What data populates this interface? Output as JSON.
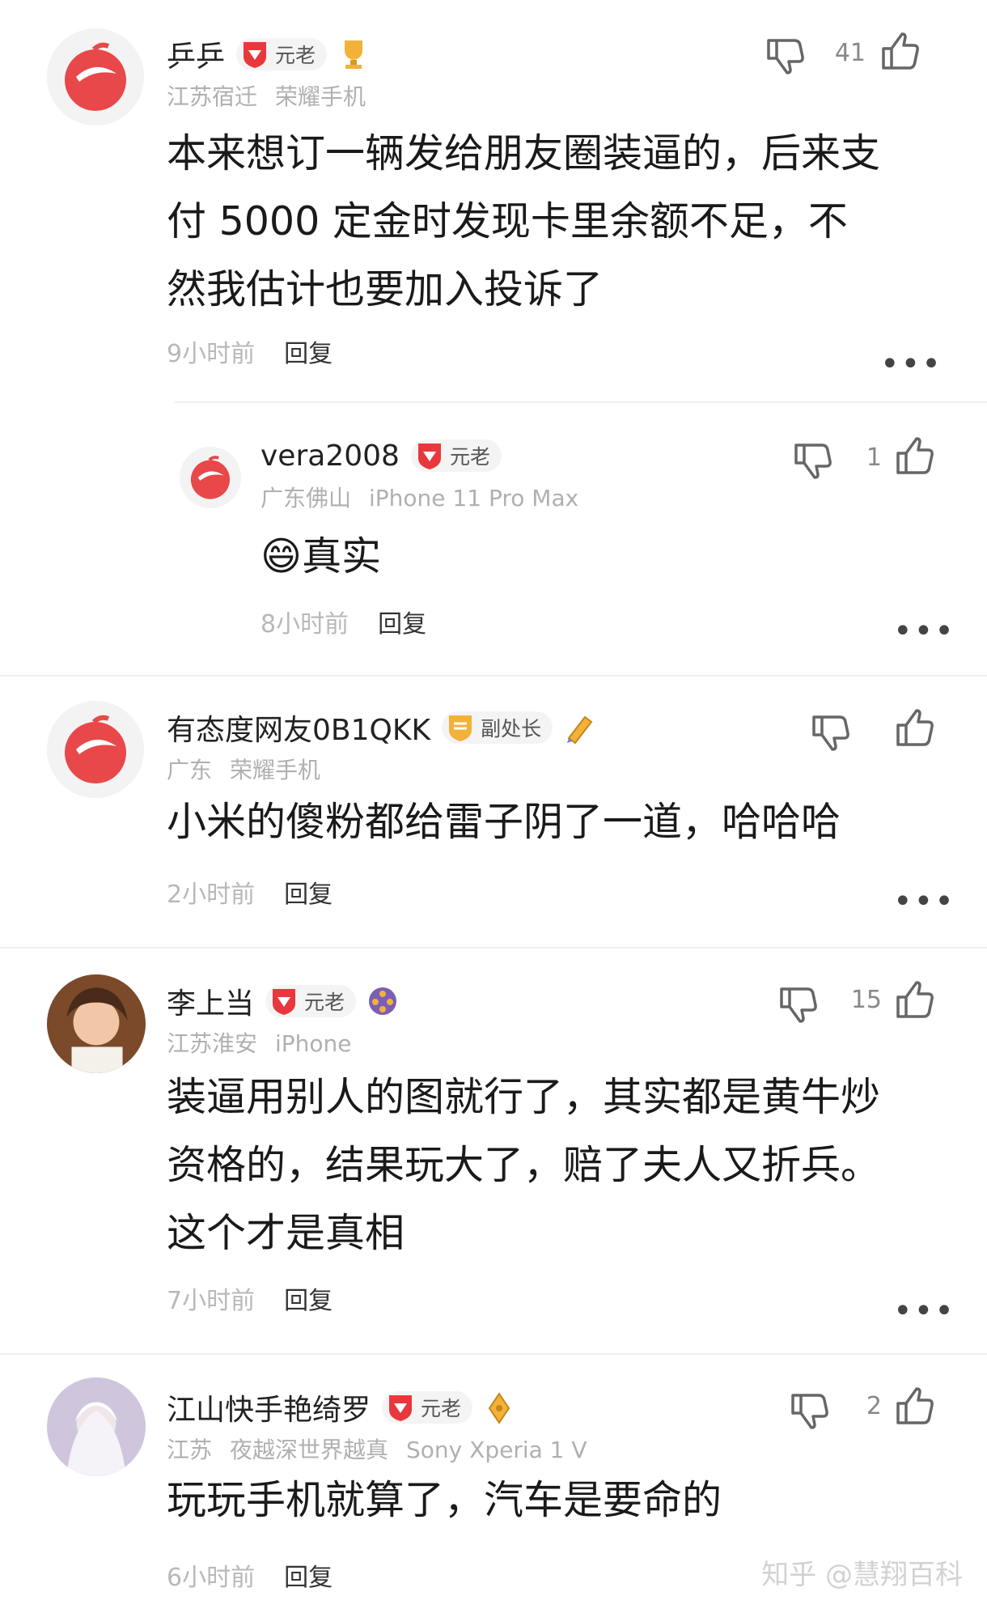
{
  "comments": [
    {
      "username": "乒乒",
      "badge": "元老",
      "location": "江苏宿迁",
      "device": "荣耀手机",
      "content_lines": [
        "本来想订一辆发给朋友圈装逼的，后来支",
        "付 5000 定金时发现卡里余额不足，不",
        "然我估计也要加入投诉了"
      ],
      "time": "9小时前",
      "reply_label": "回复",
      "like_count": "41",
      "avatar": "app-logo-avatar",
      "medal": "trophy-medal-icon"
    },
    {
      "username": "vera2008",
      "badge": "元老",
      "location": "广东佛山",
      "device": "iPhone 11 Pro Max",
      "content_lines": [
        "😄真实"
      ],
      "time": "8小时前",
      "reply_label": "回复",
      "like_count": "1",
      "avatar": "app-logo-avatar"
    },
    {
      "username": "有态度网友0B1QKK",
      "badge": "副处长",
      "location": "广东",
      "device": "荣耀手机",
      "content_lines": [
        "小米的傻粉都给雷子阴了一道，哈哈哈"
      ],
      "time": "2小时前",
      "reply_label": "回复",
      "like_count": "",
      "avatar": "app-logo-avatar",
      "medal": "pen-medal-icon"
    },
    {
      "username": "李上当",
      "badge": "元老",
      "location": "江苏淮安",
      "device": "iPhone",
      "content_lines": [
        "装逼用别人的图就行了，其实都是黄牛炒",
        "资格的，结果玩大了，赔了夫人又折兵。",
        "这个才是真相"
      ],
      "time": "7小时前",
      "reply_label": "回复",
      "like_count": "15",
      "avatar": "user-photo-avatar",
      "medal": "film-reel-medal-icon"
    },
    {
      "username": "江山快手艳绮罗",
      "badge": "元老",
      "location": "江苏",
      "device": "夜越深世界越真",
      "device2": "Sony Xperia 1 V",
      "content_lines": [
        "玩玩手机就算了，汽车是要命的"
      ],
      "time": "6小时前",
      "reply_label": "回复",
      "like_count": "2",
      "avatar": "character-photo-avatar",
      "medal": "pen-nib-medal-icon"
    }
  ],
  "more_glyph": "•••",
  "watermark": "知乎 @慧翔百科",
  "colors": {
    "badge_red": "#e8383d",
    "badge_gold": "#f2b23a",
    "brand_red": "#e8484a"
  }
}
